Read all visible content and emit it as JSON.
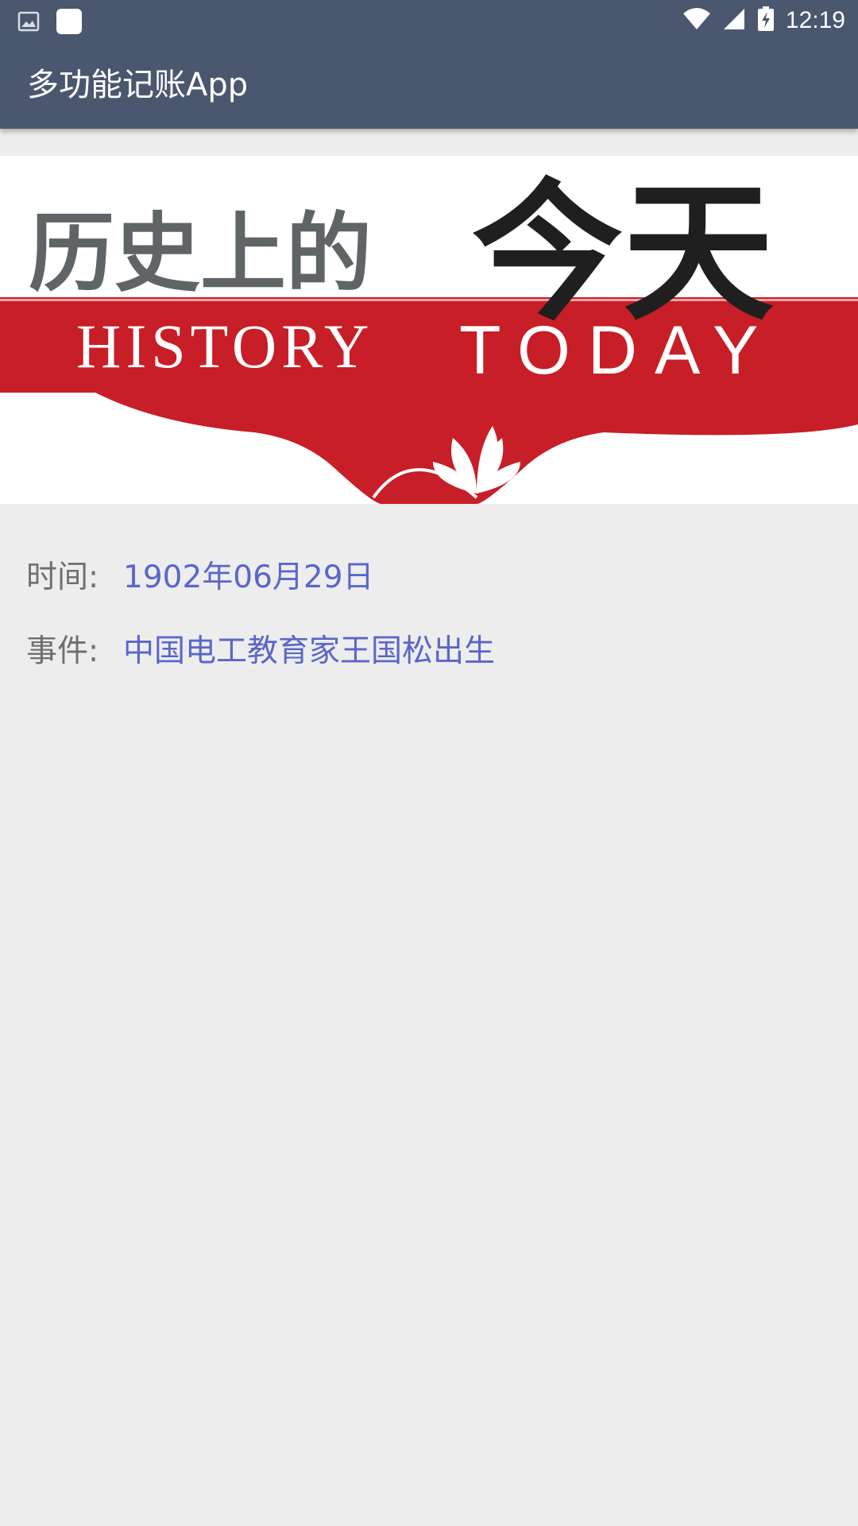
{
  "status_bar": {
    "time": "12:19",
    "icons": [
      "gallery-notification-icon",
      "app-notification-icon",
      "wifi-icon",
      "cell-signal-icon",
      "battery-charging-icon"
    ]
  },
  "app_bar": {
    "title": "多功能记账App"
  },
  "banner": {
    "title_cn_left": "历史上的",
    "title_cn_right": "今天",
    "title_en_left": "HISTORY",
    "title_en_right": "TODAY",
    "colors": {
      "red": "#C81E27",
      "dark_text": "#1F1F1F",
      "gray_text": "#5F6566"
    }
  },
  "event": {
    "time_label": "时间:",
    "time_value": "1902年06月29日",
    "event_label": "事件:",
    "event_value": "中国电工教育家王国松出生"
  },
  "colors": {
    "primary": "#4B576E",
    "background": "#EDEDED",
    "label": "#6E6E6E",
    "value": "#5A66C9"
  }
}
